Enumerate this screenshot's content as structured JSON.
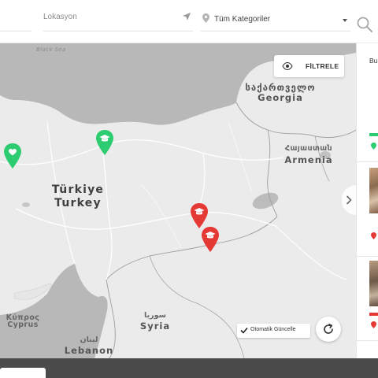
{
  "search": {
    "location_placeholder": "Lokasyon",
    "category_label": "Tüm Kategoriler"
  },
  "map": {
    "filter_label": "FİLTRELE",
    "auto_update_label": "Otomatik Güncelle",
    "auto_update_checked": true,
    "labels": {
      "black_sea": "Black Sea",
      "georgia_native": "საქართველო",
      "georgia": "Georgia",
      "armenia_native": "Հայաստան",
      "armenia": "Armenia",
      "turkiye": "Türkiye",
      "turkey": "Turkey",
      "cyprus_native": "Κύπρος",
      "cyprus": "Cyprus",
      "syria_native": "سوريا",
      "syria": "Syria",
      "lebanon_native": "لبنان",
      "lebanon": "Lebanon"
    },
    "markers": [
      {
        "category": "heart-icon",
        "color": "#2ecc71"
      },
      {
        "category": "graduation-cap-icon",
        "color": "#2ecc71"
      },
      {
        "category": "graduation-cap-icon",
        "color": "#e53935"
      },
      {
        "category": "graduation-cap-icon",
        "color": "#e53935"
      }
    ]
  },
  "panel": {
    "header": "Bu"
  },
  "colors": {
    "green": "#2ecc71",
    "red": "#e53935",
    "land": "#ebebeb",
    "water": "#b8b8b8",
    "bottom_bar": "#4b4b4b"
  }
}
